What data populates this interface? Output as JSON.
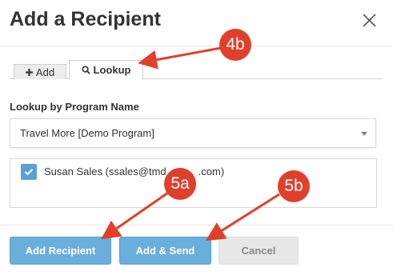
{
  "dialog": {
    "title": "Add a Recipient"
  },
  "tabs": [
    {
      "label": "Add",
      "icon": "plus-icon",
      "active": false
    },
    {
      "label": "Lookup",
      "icon": "search-icon",
      "active": true
    }
  ],
  "lookup": {
    "section_label": "Lookup by Program Name",
    "program_select_value": "Travel More [Demo Program]"
  },
  "recipients": [
    {
      "label": "Susan Sales (ssales@tmd",
      "label_tail": ".com)",
      "checked": true
    }
  ],
  "buttons": {
    "add_recipient": "Add Recipient",
    "add_send": "Add & Send",
    "cancel": "Cancel"
  },
  "annotations": {
    "badge_4b": "4b",
    "badge_5a": "5a",
    "badge_5b": "5b"
  },
  "colors": {
    "primary_button": "#6aaedb",
    "badge_red": "#e0402b",
    "checkbox_blue": "#5b9fd3"
  }
}
